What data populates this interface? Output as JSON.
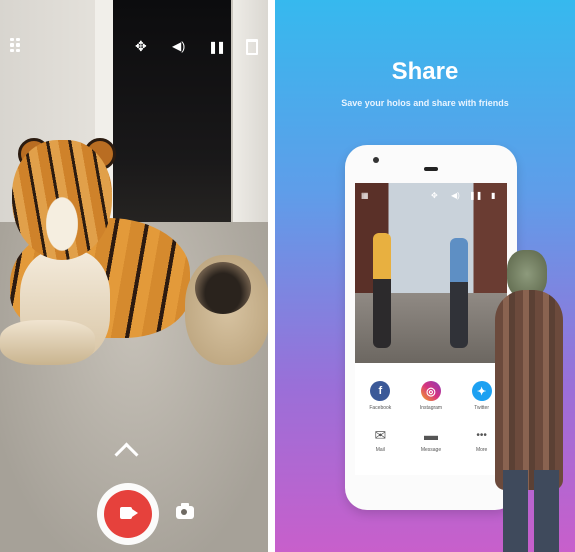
{
  "left_panel": {
    "top_icons": {
      "grid": "grid-icon",
      "move": "✥",
      "sound": "🔊",
      "pause": "❚❚",
      "trash": "trash-icon"
    },
    "bottom": {
      "chevron": "chevron-up-icon",
      "record": "video-record-icon",
      "photo": "camera-icon"
    },
    "colors": {
      "record": "#e6413c"
    }
  },
  "right_panel": {
    "title": "Share",
    "subtitle": "Save your holos and share with friends",
    "phone": {
      "mini_icons": {
        "grid": "grid-icon",
        "move": "✥",
        "sound": "◀)",
        "pause": "❚❚",
        "trash": "▮"
      },
      "share_row_1": [
        {
          "label": "Facebook",
          "glyph": "f",
          "color": "#3b5998"
        },
        {
          "label": "Instagram",
          "glyph": "◎",
          "color": "#d6337f"
        },
        {
          "label": "Twitter",
          "glyph": "✦",
          "color": "#1da1f2"
        }
      ],
      "share_row_2": [
        {
          "label": "Mail",
          "glyph": "✉"
        },
        {
          "label": "Message",
          "glyph": "▬"
        },
        {
          "label": "More",
          "glyph": "•••"
        }
      ]
    },
    "colors": {
      "gradient_top": "#36b9ee",
      "gradient_bottom": "#c85fcb"
    }
  }
}
